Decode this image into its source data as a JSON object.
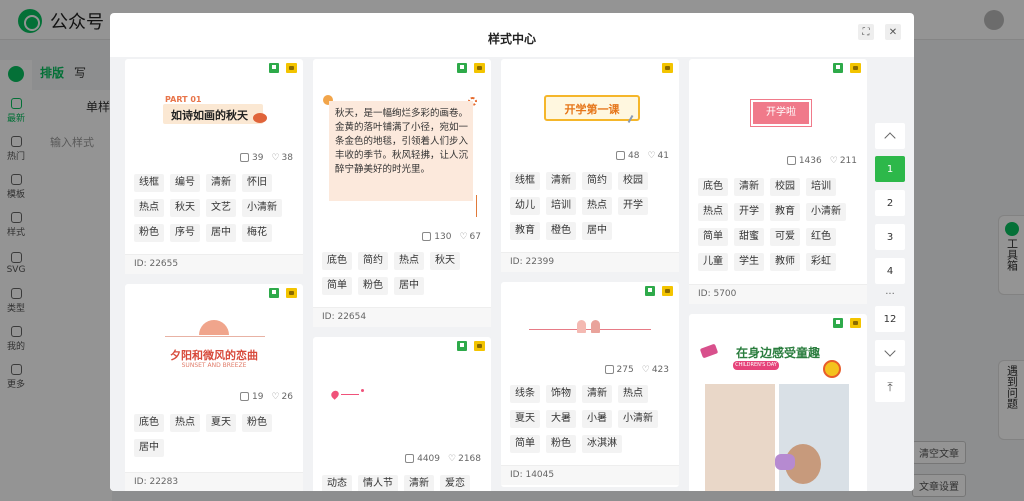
{
  "app": {
    "brand": "公众号",
    "nav": [
      {
        "label": "最新",
        "active": true
      },
      {
        "label": "热门"
      },
      {
        "label": "模板"
      },
      {
        "label": "样式"
      },
      {
        "label": "SVG"
      },
      {
        "label": "类型"
      },
      {
        "label": "我的"
      },
      {
        "label": "更多"
      }
    ],
    "sub_tabs": [
      "排版",
      "写"
    ],
    "side_title": "单样式",
    "search_placeholder": "输入样式",
    "tool_label": "工具箱",
    "help_label": "遇到问题",
    "btn_clear": "清空文章",
    "btn_settings": "文章设置"
  },
  "modal": {
    "title": "样式中心"
  },
  "cards": [
    {
      "col": 0,
      "preview": "title",
      "part_label": "PART 01",
      "heading": "如诗如画的秋天",
      "copies": "39",
      "likes": "38",
      "tags": [
        "线框",
        "编号",
        "清新",
        "怀旧",
        "热点",
        "秋天",
        "文艺",
        "小清新",
        "粉色",
        "序号",
        "居中",
        "梅花"
      ],
      "id": "ID: 22655"
    },
    {
      "col": 0,
      "preview": "sunset",
      "heading": "夕阳和微风的恋曲",
      "sub": "SUNSET AND BREEZE",
      "copies": "19",
      "likes": "26",
      "tags": [
        "底色",
        "热点",
        "夏天",
        "粉色",
        "居中"
      ],
      "id": "ID: 22283"
    },
    {
      "col": 1,
      "preview": "autumn_text",
      "heading": "秋天，是一幅绚烂多彩的画卷。金黄的落叶铺满了小径，宛如一条金色的地毯，引领着人们步入丰收的季节。秋风轻拂，让人沉醉宁静美好的时光里。",
      "copies": "130",
      "likes": "67",
      "tags": [
        "底色",
        "简约",
        "热点",
        "秋天",
        "简单",
        "粉色",
        "居中"
      ],
      "id": "ID: 22654"
    },
    {
      "col": 1,
      "preview": "arrow",
      "copies": "4409",
      "likes": "2168",
      "tags": [
        "动态",
        "情人节",
        "清新",
        "爱恋"
      ],
      "id": ""
    },
    {
      "col": 2,
      "preview": "school",
      "heading": "开学第一课",
      "copies": "48",
      "likes": "41",
      "tags": [
        "线框",
        "清新",
        "简约",
        "校园",
        "幼儿",
        "培训",
        "热点",
        "开学",
        "教育",
        "橙色",
        "居中"
      ],
      "id": "ID: 22399"
    },
    {
      "col": 2,
      "preview": "icecream",
      "copies": "275",
      "likes": "423",
      "tags": [
        "线条",
        "饰物",
        "清新",
        "热点",
        "夏天",
        "大暑",
        "小暑",
        "小清新",
        "简单",
        "粉色",
        "冰淇淋"
      ],
      "id": "ID: 14045"
    },
    {
      "col": 3,
      "preview": "button",
      "heading": "开学啦",
      "copies": "1436",
      "likes": "211",
      "tags": [
        "底色",
        "清新",
        "校园",
        "培训",
        "热点",
        "开学",
        "教育",
        "小清新",
        "简单",
        "甜蜜",
        "可爱",
        "红色",
        "儿童",
        "学生",
        "教师",
        "彩虹"
      ],
      "id": "ID: 5700"
    },
    {
      "col": 3,
      "preview": "children",
      "heading": "在身边感受童趣",
      "sub": "CHILDREN'S DAY",
      "copies": "",
      "likes": "",
      "tags": [],
      "id": ""
    }
  ],
  "pager": {
    "pages": [
      "1",
      "2",
      "3",
      "4",
      "12"
    ],
    "current": "1",
    "ellipsis": "..."
  },
  "colors": {
    "accent": "#2db84a",
    "tag_bg": "#f3f3f3",
    "pink": "#f07a8a"
  }
}
